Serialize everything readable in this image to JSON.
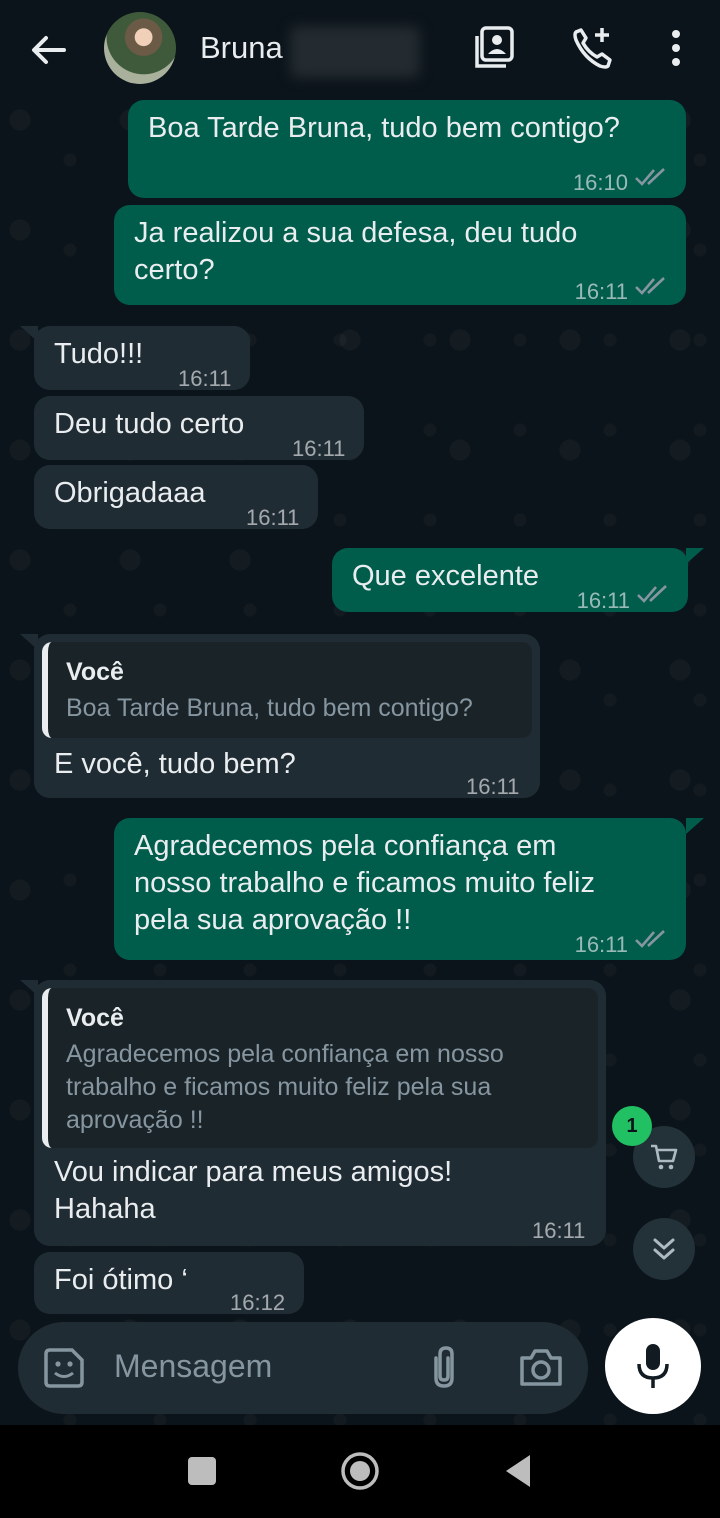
{
  "header": {
    "contact_name": "Bruna"
  },
  "messages": [
    {
      "dir": "out",
      "text": "Boa Tarde Bruna, tudo bem contigo?",
      "time": "16:10"
    },
    {
      "dir": "out",
      "text": "Ja realizou a sua defesa, deu tudo\ncerto?",
      "time": "16:11"
    },
    {
      "dir": "in",
      "text": "Tudo!!!",
      "time": "16:11"
    },
    {
      "dir": "in",
      "text": "Deu tudo certo",
      "time": "16:11"
    },
    {
      "dir": "in",
      "text": "Obrigadaaa",
      "time": "16:11"
    },
    {
      "dir": "out",
      "text": "Que excelente",
      "time": "16:11"
    },
    {
      "dir": "in",
      "quote_author": "Você",
      "quote_text": "Boa Tarde Bruna, tudo bem contigo?",
      "text": "E você, tudo bem?",
      "time": "16:11"
    },
    {
      "dir": "out",
      "text": "Agradecemos pela confiança em\nnosso trabalho e ficamos muito feliz\npela sua aprovação !!",
      "time": "16:11"
    },
    {
      "dir": "in",
      "quote_author": "Você",
      "quote_text": "Agradecemos pela confiança em nosso\ntrabalho e ficamos muito feliz pela sua\naprovação !!",
      "text": "Vou indicar para meus amigos!\nHahaha",
      "time": "16:11"
    },
    {
      "dir": "in",
      "text": "Foi ótimo ‘",
      "time": "16:12"
    }
  ],
  "cart_badge": "1",
  "composer": {
    "placeholder": "Mensagem"
  },
  "colors": {
    "outgoing_bubble": "#005c4b",
    "incoming_bubble": "#202c33",
    "background": "#0b141a",
    "accent": "#21c063"
  }
}
